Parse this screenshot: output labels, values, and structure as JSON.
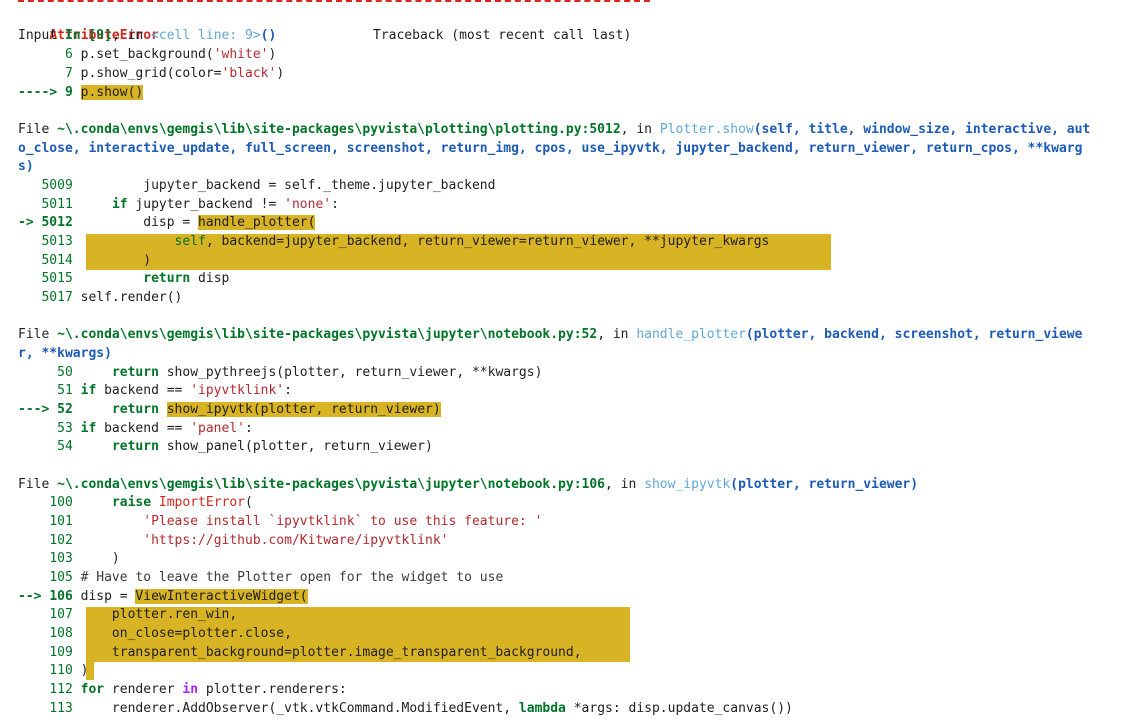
{
  "error": {
    "type": "AttributeError",
    "traceback_label": "Traceback (most recent call last)"
  },
  "input": {
    "prefix": "Input ",
    "cell": "In [9]",
    "sep": ", in ",
    "location": "<cell line: 9>",
    "suffix": "()",
    "lines": [
      {
        "arrow": "      ",
        "num": "6",
        "code": "p.set_background('white')"
      },
      {
        "arrow": "      ",
        "num": "7",
        "code": "p.show_grid(color='black')"
      },
      {
        "arrow": "---->",
        "num": "9",
        "code": "p.show()"
      }
    ]
  },
  "frames": [
    {
      "file_label": "File ",
      "path": "~\\.conda\\envs\\gemgis\\lib\\site-packages\\pyvista\\plotting\\plotting.py:5012",
      "in": ", in ",
      "func": "Plotter.show",
      "signature": "(self, title, window_size, interactive, auto_close, interactive_update, full_screen, screenshot, return_img, cpos, use_ipyvtk, jupyter_backend, return_viewer, return_cpos, **kwargs)",
      "lines": [
        {
          "arrow": "",
          "num": "5009",
          "code": "        jupyter_backend = self._theme.jupyter_backend"
        },
        {
          "arrow": "",
          "num": "5011",
          "code": "    if jupyter_backend != 'none':"
        },
        {
          "arrow": "-> ",
          "num": "5012",
          "code": "        disp = handle_plotter("
        },
        {
          "arrow": "",
          "num": "5013",
          "code": "            self, backend=jupyter_backend, return_viewer=return_viewer, **jupyter_kwargs"
        },
        {
          "arrow": "",
          "num": "5014",
          "code": "        )"
        },
        {
          "arrow": "",
          "num": "5015",
          "code": "        return disp"
        },
        {
          "arrow": "",
          "num": "5017",
          "code": "self.render()"
        }
      ]
    },
    {
      "file_label": "File ",
      "path": "~\\.conda\\envs\\gemgis\\lib\\site-packages\\pyvista\\jupyter\\notebook.py:52",
      "in": ", in ",
      "func": "handle_plotter",
      "signature": "(plotter, backend, screenshot, return_viewer, **kwargs)",
      "lines": [
        {
          "arrow": "",
          "num": "50",
          "code": "    return show_pythreejs(plotter, return_viewer, **kwargs)"
        },
        {
          "arrow": "",
          "num": "51",
          "code": "if backend == 'ipyvtklink':"
        },
        {
          "arrow": "---> ",
          "num": "52",
          "code": "    return show_ipyvtk(plotter, return_viewer)"
        },
        {
          "arrow": "",
          "num": "53",
          "code": "if backend == 'panel':"
        },
        {
          "arrow": "",
          "num": "54",
          "code": "    return show_panel(plotter, return_viewer)"
        }
      ]
    },
    {
      "file_label": "File ",
      "path": "~\\.conda\\envs\\gemgis\\lib\\site-packages\\pyvista\\jupyter\\notebook.py:106",
      "in": ", in ",
      "func": "show_ipyvtk",
      "signature": "(plotter, return_viewer)",
      "lines": [
        {
          "arrow": "",
          "num": "100",
          "code": "    raise ImportError("
        },
        {
          "arrow": "",
          "num": "101",
          "code": "        'Please install `ipyvtklink` to use this feature: '"
        },
        {
          "arrow": "",
          "num": "102",
          "code": "        'https://github.com/Kitware/ipyvtklink'"
        },
        {
          "arrow": "",
          "num": "103",
          "code": "    )"
        },
        {
          "arrow": "",
          "num": "105",
          "code": "# Have to leave the Plotter open for the widget to use"
        },
        {
          "arrow": "--> ",
          "num": "106",
          "code": "disp = ViewInteractiveWidget("
        },
        {
          "arrow": "",
          "num": "107",
          "code": "    plotter.ren_win,"
        },
        {
          "arrow": "",
          "num": "108",
          "code": "    on_close=plotter.close,"
        },
        {
          "arrow": "",
          "num": "109",
          "code": "    transparent_background=plotter.image_transparent_background,"
        },
        {
          "arrow": "",
          "num": "110",
          "code": ")"
        },
        {
          "arrow": "",
          "num": "112",
          "code": "for renderer in plotter.renderers:"
        },
        {
          "arrow": "",
          "num": "113",
          "code": "    renderer.AddObserver(_vtk.vtkCommand.ModifiedEvent, lambda *args: disp.update_canvas())"
        }
      ]
    }
  ]
}
